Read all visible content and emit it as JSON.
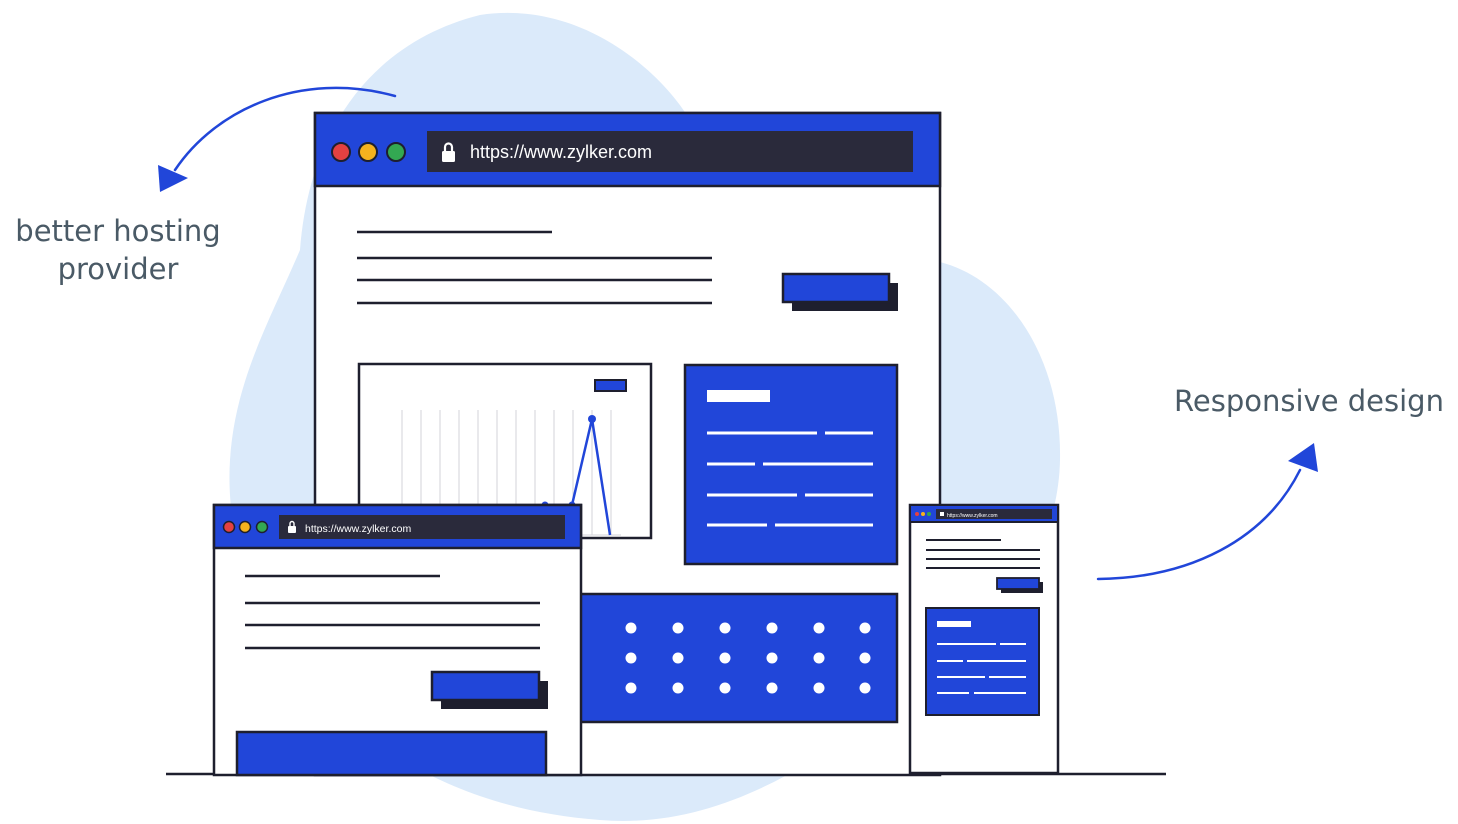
{
  "labels": {
    "hosting_line1": "better hosting",
    "hosting_line2": "provider",
    "responsive": "Responsive design"
  },
  "desktop_window": {
    "url": "https://www.zylker.com"
  },
  "tablet_window": {
    "url": "https://www.zylker.com"
  },
  "phone_window": {
    "url": "https://www.zylker.com"
  },
  "colors": {
    "primary": "#2146d9",
    "outline": "#1e1f2e",
    "urlbar": "#2a2a3b",
    "blob": "#dbeafa",
    "label_text": "#4a5a66",
    "dot_red": "#e34141",
    "dot_yellow": "#f5b21e",
    "dot_green": "#33a852"
  }
}
